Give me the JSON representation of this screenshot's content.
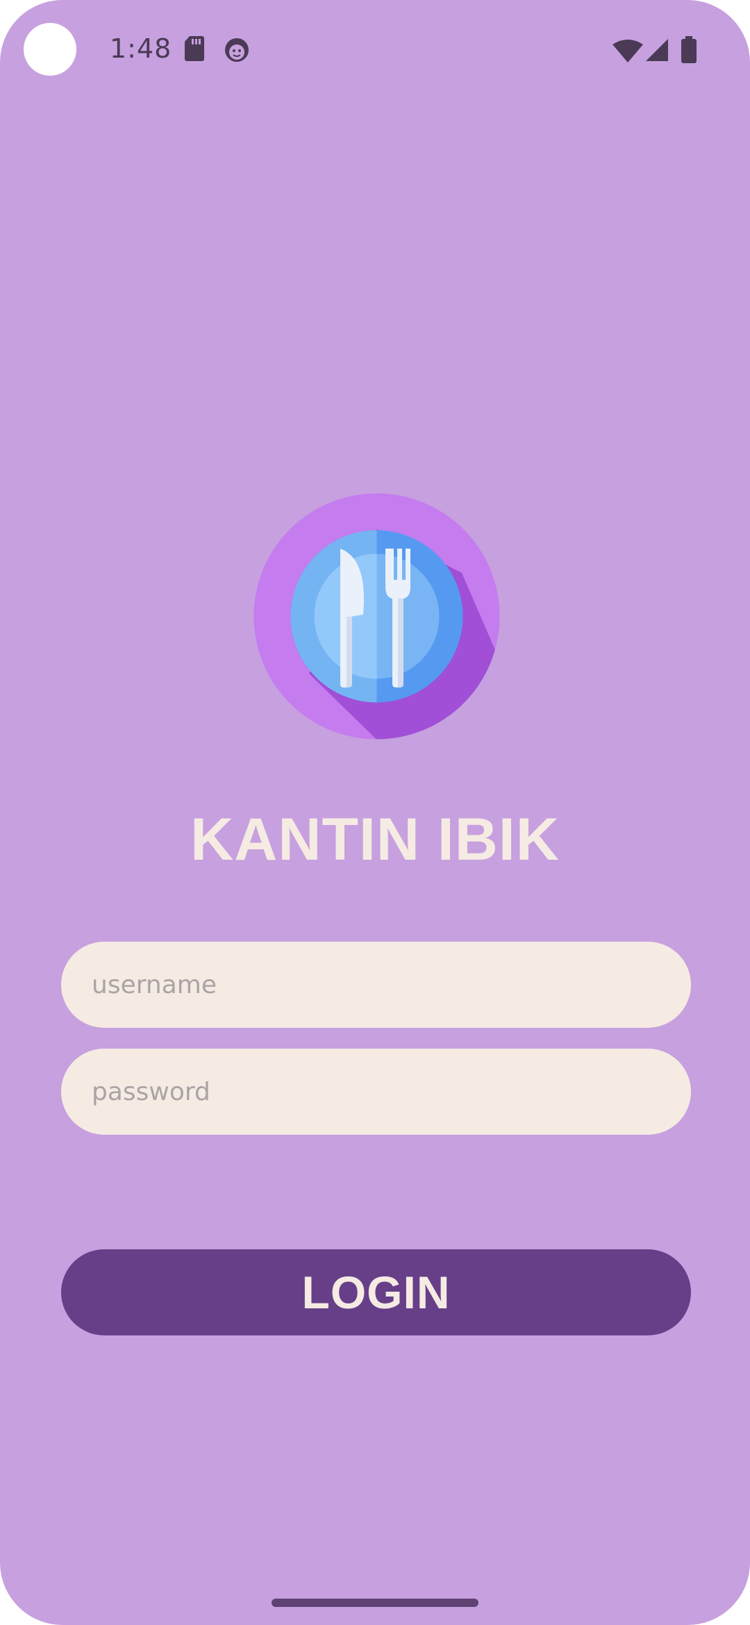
{
  "status_bar": {
    "time": "1:48",
    "icons": [
      "sd-card-icon",
      "face-notification-icon",
      "wifi-icon",
      "cell-signal-icon",
      "battery-icon"
    ]
  },
  "logo": {
    "icon": "knife-fork-plate-icon"
  },
  "app": {
    "title": "KANTIN IBIK"
  },
  "form": {
    "username_placeholder": "username",
    "username_value": "",
    "password_placeholder": "password",
    "password_value": "",
    "login_label": "LOGIN"
  },
  "colors": {
    "background": "#c7a0df",
    "field_bg": "#f5ebe3",
    "button_bg": "#673f89",
    "title_text": "#f5ebe3"
  }
}
